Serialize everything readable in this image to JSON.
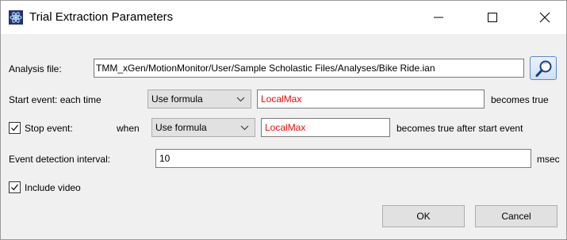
{
  "window": {
    "title": "Trial Extraction Parameters"
  },
  "analysis_file": {
    "label": "Analysis file:",
    "value": "TMM_xGen/MotionMonitor/User/Sample Scholastic Files/Analyses/Bike Ride.ian",
    "browse_icon": "search-icon"
  },
  "start_event": {
    "label": "Start event: each time",
    "mode": "Use formula",
    "formula": "LocalMax",
    "suffix": "becomes true"
  },
  "stop_event": {
    "checked": true,
    "label": "Stop event:",
    "when_label": "when",
    "mode": "Use formula",
    "formula": "LocalMax",
    "suffix": "becomes true after start event"
  },
  "detection_interval": {
    "label": "Event detection interval:",
    "value": "10",
    "unit": "msec"
  },
  "include_video": {
    "checked": true,
    "label": "Include video"
  },
  "buttons": {
    "ok": "OK",
    "cancel": "Cancel"
  },
  "colors": {
    "formula_text": "#e01010",
    "dialog_bg": "#f0f0f0"
  }
}
